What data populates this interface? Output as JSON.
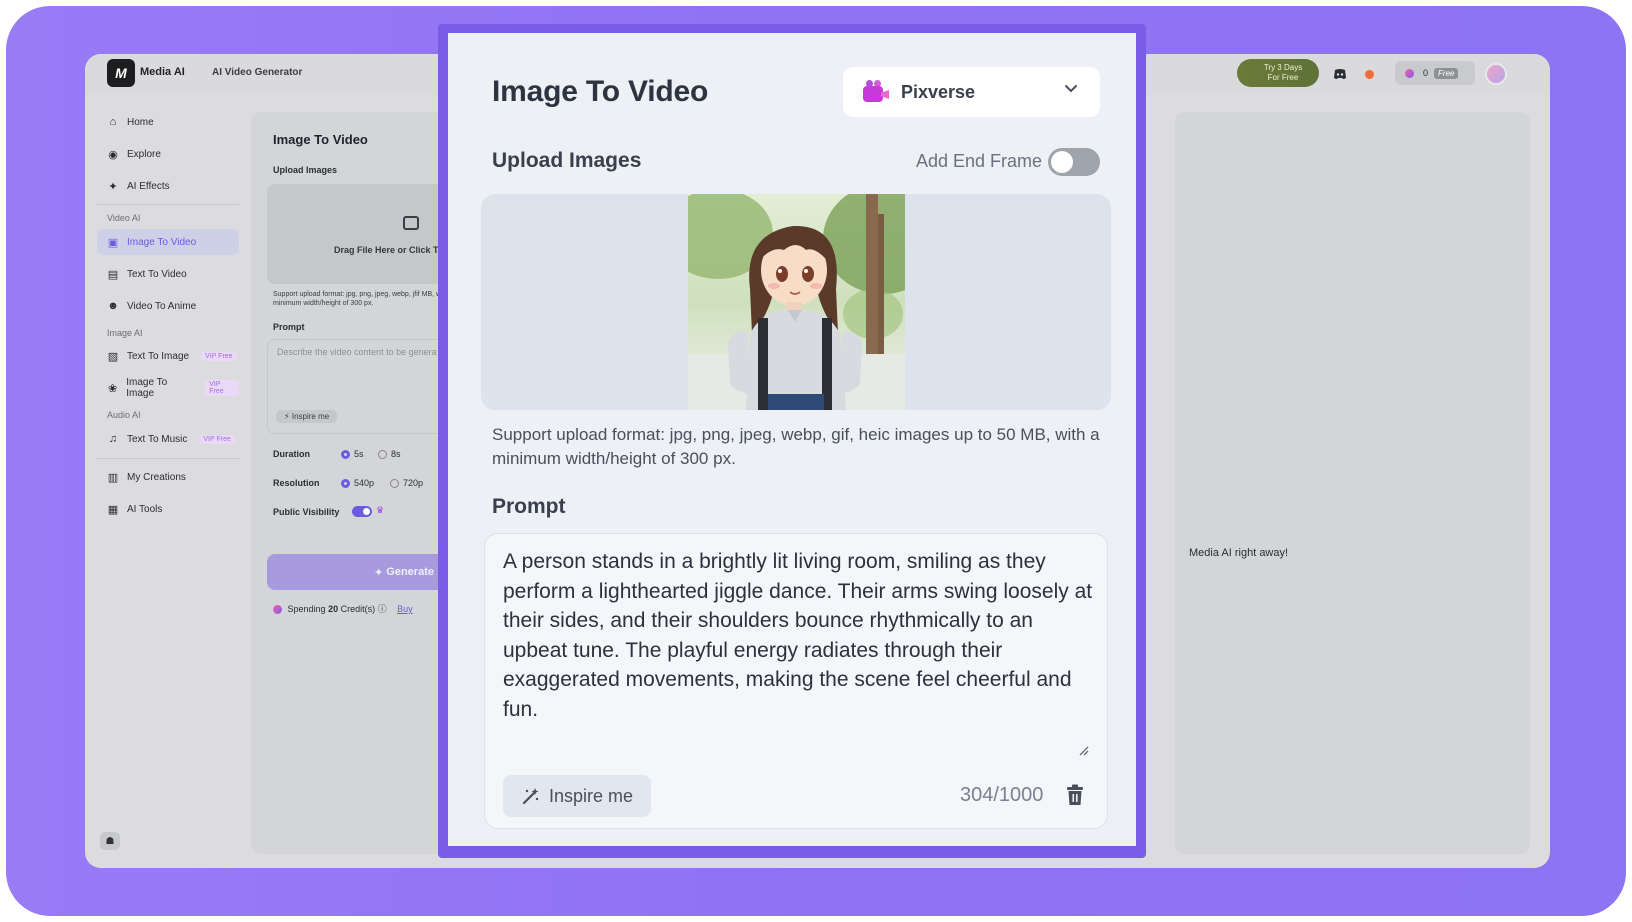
{
  "colors": {
    "frame": "#8f72f4",
    "accent": "#6c5ae0",
    "modal_bg": "#edf0f5"
  },
  "topbar": {
    "logo_glyph": "M",
    "app_name": "Media AI",
    "app_subtitle": "AI Video Generator",
    "trial": {
      "line1": "Try 3 Days",
      "line2": "For Free"
    },
    "credits": "0",
    "plan": "Free",
    "icons": [
      "discord-icon",
      "notification-dot-icon",
      "credit-coin-icon",
      "avatar"
    ]
  },
  "sidebar": {
    "items": [
      {
        "label": "Home",
        "icon": "home-icon"
      },
      {
        "label": "Explore",
        "icon": "compass-icon"
      },
      {
        "label": "AI Effects",
        "icon": "sparkle-icon"
      }
    ],
    "section_video": "Video AI",
    "video_items": [
      {
        "label": "Image To Video",
        "icon": "image-video-icon",
        "active": true
      },
      {
        "label": "Text To Video",
        "icon": "text-video-icon"
      },
      {
        "label": "Video To Anime",
        "icon": "anime-icon"
      }
    ],
    "section_image": "Image AI",
    "image_items": [
      {
        "label": "Text To Image",
        "badge": "VIP Free",
        "icon": "text-image-icon"
      },
      {
        "label": "Image To Image",
        "badge": "VIP Free",
        "icon": "image-image-icon"
      }
    ],
    "section_audio": "Audio AI",
    "audio_items": [
      {
        "label": "Text To Music",
        "badge": "VIP Free",
        "icon": "music-icon"
      }
    ],
    "bottom_items": [
      {
        "label": "My Creations",
        "icon": "creations-icon"
      },
      {
        "label": "AI Tools",
        "icon": "tools-icon"
      }
    ]
  },
  "background_panel": {
    "title": "Image To Video",
    "upload_label": "Upload Images",
    "drop_text": "Drag File Here or Click To",
    "support_text": "Support upload format: jpg, png, jpeg, webp, jfif MB, with a minimum width/height of 300 px.",
    "prompt_label": "Prompt",
    "prompt_placeholder": "Describe the video content to be genera picture",
    "inspire_label": "Inspire me",
    "duration_label": "Duration",
    "duration_options": [
      "5s",
      "8s"
    ],
    "resolution_label": "Resolution",
    "resolution_options": [
      "540p",
      "720p"
    ],
    "visibility_label": "Public Visibility",
    "generate_label": "Generate",
    "spending_prefix": "Spending",
    "spending_amount": "20",
    "spending_suffix": "Credit(s)",
    "buy_label": "Buy"
  },
  "right_pane": {
    "message": "Media AI right away!"
  },
  "modal": {
    "title": "Image To Video",
    "model": "Pixverse",
    "upload_label": "Upload Images",
    "end_frame_label": "Add End Frame",
    "end_frame_enabled": false,
    "support_text": "Support upload format: jpg, png, jpeg, webp, gif, heic images up to 50 MB, with a minimum width/height of 300 px.",
    "prompt_label": "Prompt",
    "prompt_value": "A person stands in a brightly lit living room, smiling as they perform a lighthearted jiggle dance. Their arms swing loosely at their sides, and their shoulders bounce rhythmically to an upbeat tune. The playful energy radiates through their exaggerated movements, making the scene feel cheerful and fun.",
    "inspire_label": "Inspire me",
    "char_count": "304/1000"
  }
}
